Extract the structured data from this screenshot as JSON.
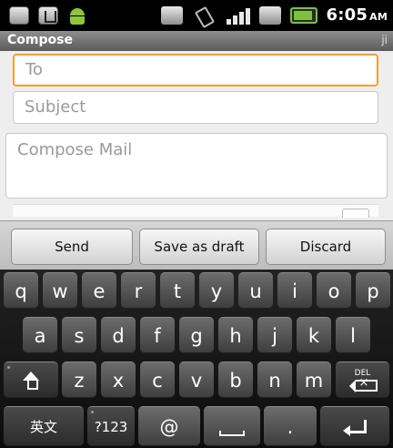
{
  "status_bar": {
    "time": "6:05",
    "ampm": "AM",
    "icons": [
      "usb-debug-icon",
      "usb-icon",
      "android-icon",
      "wifi-icon",
      "vibrate-icon",
      "signal-icon",
      "no-signal-icon",
      "battery-icon"
    ]
  },
  "title_bar": {
    "title": "Compose",
    "trailing": "ji"
  },
  "compose": {
    "to_placeholder": "To",
    "subject_placeholder": "Subject",
    "body_placeholder": "Compose Mail"
  },
  "actions": {
    "send_label": "Send",
    "draft_label": "Save as draft",
    "discard_label": "Discard"
  },
  "keyboard": {
    "row1": [
      "q",
      "w",
      "e",
      "r",
      "t",
      "y",
      "u",
      "i",
      "o",
      "p"
    ],
    "row2": [
      "a",
      "s",
      "d",
      "f",
      "g",
      "h",
      "j",
      "k",
      "l"
    ],
    "row3": [
      "z",
      "x",
      "c",
      "v",
      "b",
      "n",
      "m"
    ],
    "lang_label": "英文",
    "symbols_label": "?123",
    "at_label": "@",
    "period_label": ".",
    "delete_label": "DEL"
  },
  "colors": {
    "focus_border": "#f29f2c",
    "key_bg": "#4f4f4f",
    "keyboard_bg": "#161616"
  }
}
